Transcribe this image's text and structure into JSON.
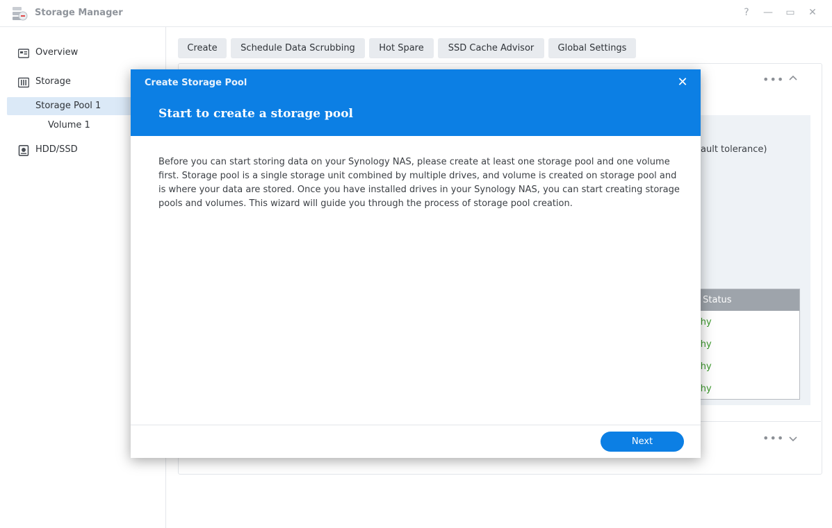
{
  "window": {
    "title": "Storage Manager",
    "help_icon": "?",
    "minimize_icon": "—",
    "maximize_icon": "▭",
    "close_icon": "✕"
  },
  "sidebar": {
    "items": [
      {
        "label": "Overview",
        "icon": "overview-icon"
      },
      {
        "label": "Storage",
        "icon": "storage-icon"
      },
      {
        "label": "Storage Pool 1"
      },
      {
        "label": "Volume 1"
      },
      {
        "label": "HDD/SSD",
        "icon": "drive-icon"
      }
    ]
  },
  "toolbar": {
    "buttons": [
      "Create",
      "Schedule Data Scrubbing",
      "Hot Spare",
      "SSD Cache Advisor",
      "Global Settings"
    ]
  },
  "background": {
    "fault_tolerance_text": "ault tolerance)",
    "status_header": "e Status",
    "status_rows": [
      "lthy",
      "lthy",
      "lthy",
      "lthy"
    ],
    "healthy_color": "#3a9a2a"
  },
  "modal": {
    "title": "Create Storage Pool",
    "heading": "Start to create a storage pool",
    "body": "Before you can start storing data on your Synology NAS, please create at least one storage pool and one volume first. Storage pool is a single storage unit combined by multiple drives, and volume is created on storage pool and is where your data are stored. Once you have installed drives in your Synology NAS, you can start creating storage pools and volumes. This wizard will guide you through the process of storage pool creation.",
    "next_label": "Next",
    "close_icon": "✕",
    "accent_color": "#0c7fe4"
  }
}
